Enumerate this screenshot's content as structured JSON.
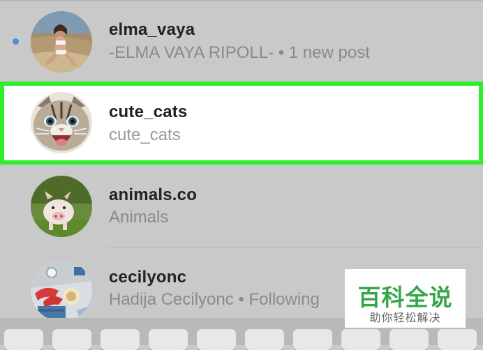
{
  "accounts": [
    {
      "username": "elma_vaya",
      "subtitle": "-ELMA VAYA RIPOLL- • 1 new post",
      "unread": true,
      "avatar_icon": "person-avatar-icon"
    },
    {
      "username": "cute_cats",
      "subtitle": "cute_cats",
      "highlighted": true,
      "avatar_icon": "cat-avatar-icon"
    },
    {
      "username": "animals.co",
      "subtitle": "Animals",
      "avatar_icon": "piglet-avatar-icon"
    },
    {
      "username": "cecilyonc",
      "subtitle": "Hadija Cecilyonc • Following",
      "avatar_icon": "shoes-avatar-icon"
    }
  ],
  "watermark": {
    "title": "百科全说",
    "subtitle": "助你轻松解决"
  },
  "colors": {
    "highlight": "#2ef02a",
    "unread_dot": "#4a8fdd",
    "watermark_green": "#35a649"
  }
}
